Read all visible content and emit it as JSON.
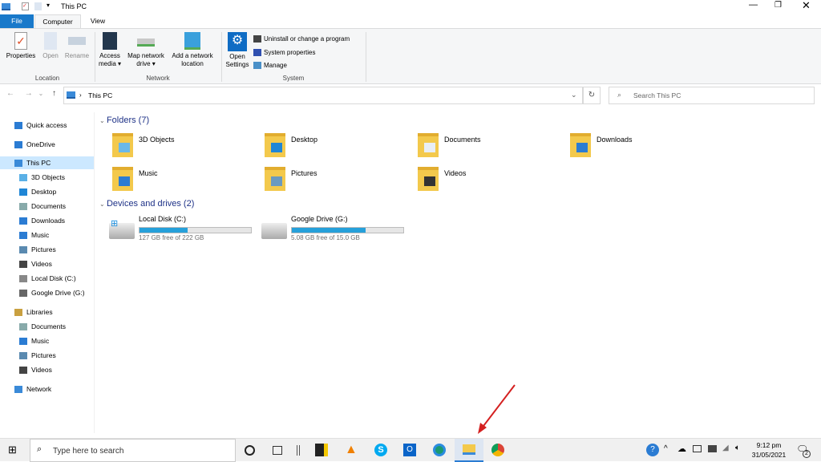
{
  "window": {
    "title": "This PC"
  },
  "tabs": [
    {
      "label": "File"
    },
    {
      "label": "Computer"
    },
    {
      "label": "View"
    }
  ],
  "ribbon": {
    "location": {
      "label": "Location",
      "buttons": [
        {
          "label": "Properties",
          "icon": "properties-icon"
        },
        {
          "label": "Open",
          "icon": "open-icon"
        },
        {
          "label": "Rename",
          "icon": "rename-icon"
        }
      ]
    },
    "network": {
      "label": "Network",
      "buttons": [
        {
          "label": "Access media ▾",
          "icon": "access-media-icon"
        },
        {
          "label": "Map network drive ▾",
          "icon": "map-drive-icon"
        },
        {
          "label": "Add a network location",
          "icon": "network-location-icon"
        }
      ]
    },
    "system": {
      "label": "System",
      "open_settings": "Open Settings",
      "items": [
        {
          "label": "Uninstall or change a program"
        },
        {
          "label": "System properties"
        },
        {
          "label": "Manage"
        }
      ]
    }
  },
  "address": {
    "path": "This PC",
    "search_placeholder": "Search This PC"
  },
  "nav": [
    {
      "label": "Quick access",
      "indent": 0,
      "icon": "star-icon"
    },
    {
      "label": "OneDrive",
      "indent": 0,
      "icon": "cloud-icon"
    },
    {
      "label": "This PC",
      "indent": 0,
      "icon": "pc-icon",
      "selected": true
    },
    {
      "label": "3D Objects",
      "indent": 1
    },
    {
      "label": "Desktop",
      "indent": 1
    },
    {
      "label": "Documents",
      "indent": 1
    },
    {
      "label": "Downloads",
      "indent": 1
    },
    {
      "label": "Music",
      "indent": 1
    },
    {
      "label": "Pictures",
      "indent": 1
    },
    {
      "label": "Videos",
      "indent": 1
    },
    {
      "label": "Local Disk (C:)",
      "indent": 1
    },
    {
      "label": "Google Drive (G:)",
      "indent": 1
    },
    {
      "label": "Libraries",
      "indent": 0
    },
    {
      "label": "Documents",
      "indent": 1
    },
    {
      "label": "Music",
      "indent": 1
    },
    {
      "label": "Pictures",
      "indent": 1
    },
    {
      "label": "Videos",
      "indent": 1
    },
    {
      "label": "Network",
      "indent": 0
    }
  ],
  "folders_header": "Folders (7)",
  "folders": [
    {
      "name": "3D Objects"
    },
    {
      "name": "Desktop"
    },
    {
      "name": "Documents"
    },
    {
      "name": "Downloads"
    },
    {
      "name": "Music"
    },
    {
      "name": "Pictures"
    },
    {
      "name": "Videos"
    }
  ],
  "drives_header": "Devices and drives (2)",
  "drives": [
    {
      "name": "Local Disk (C:)",
      "free": "127 GB free of 222 GB",
      "used_fraction": 0.43
    },
    {
      "name": "Google Drive (G:)",
      "free": "5.08 GB free of 15.0 GB",
      "used_fraction": 0.66
    }
  ],
  "taskbar": {
    "search_placeholder": "Type here to search",
    "time": "9:12 pm",
    "date": "31/05/2021",
    "notifications": "2"
  },
  "colors": {
    "accent": "#0063b1",
    "drive_bar": "#26a0da",
    "annotation_arrow": "#d42020"
  }
}
